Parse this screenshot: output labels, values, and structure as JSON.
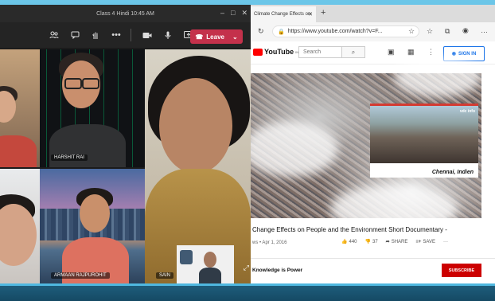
{
  "teams": {
    "window_title": "Class 4 Hindi 10:45 AM",
    "leave_label": "Leave",
    "participants": [
      {
        "name": ""
      },
      {
        "name": "HARSHIT RAI"
      },
      {
        "name": ""
      },
      {
        "name": ""
      },
      {
        "name": "ARMAAN RAJPUROHIT"
      },
      {
        "name": "SAIN"
      }
    ],
    "icons": [
      "people-icon",
      "chat-icon",
      "raise-hand-icon",
      "more-icon",
      "camera-icon",
      "mic-icon",
      "share-icon",
      "phone-icon"
    ]
  },
  "edge": {
    "tab_title": "Climate Change Effects on",
    "url": "https://www.youtube.com/watch?v=F...",
    "youtube": {
      "logo_text": "YouTube",
      "logo_suffix": "IN",
      "search_placeholder": "Search",
      "signin_label": "SIGN IN",
      "inset_caption": "Chennai, Indien",
      "inset_logo": "vdc info",
      "video_title": "Change Effects on People and the Environment Short Documentary -",
      "meta": "ws • Apr 1, 2016",
      "likes": "440",
      "dislikes": "37",
      "share_label": "SHARE",
      "save_label": "SAVE",
      "channel": "Knowledge is Power",
      "subscribe_label": "SUBSCRIBE"
    }
  }
}
